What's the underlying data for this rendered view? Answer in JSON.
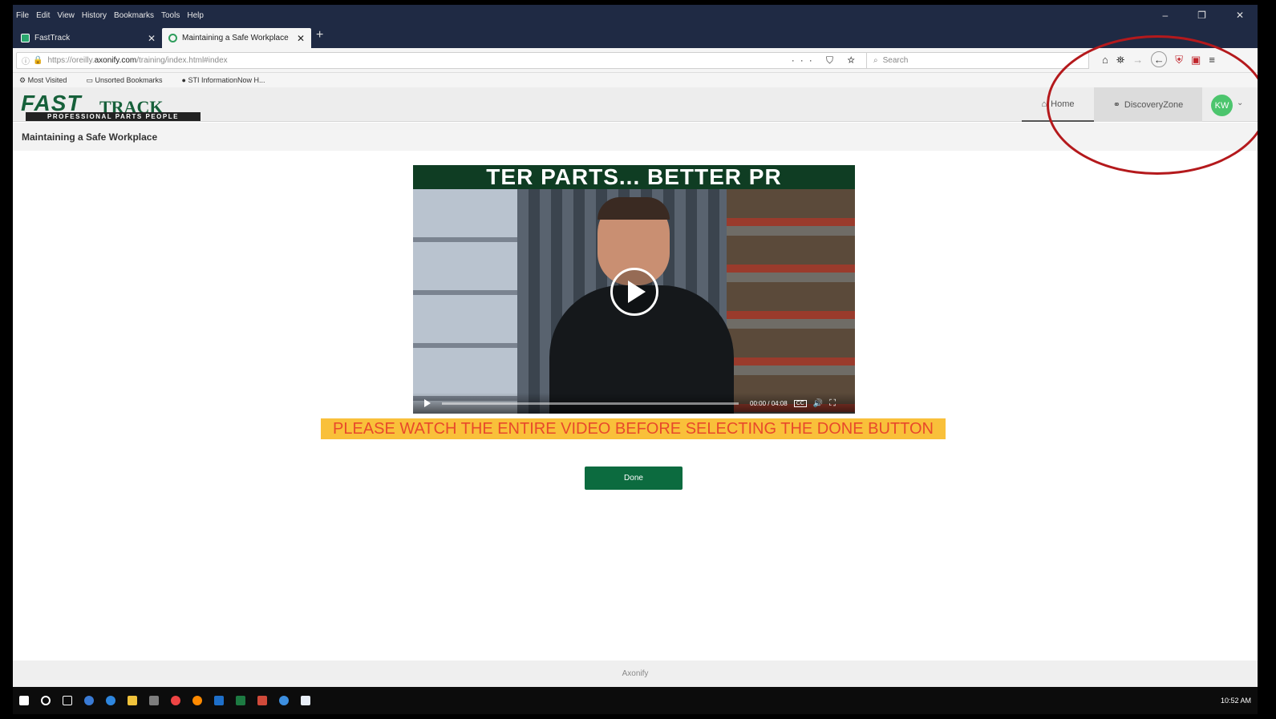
{
  "menu": [
    "File",
    "Edit",
    "View",
    "History",
    "Bookmarks",
    "Tools",
    "Help"
  ],
  "window_controls": {
    "minimize": "–",
    "restore": "❐",
    "close": "✕"
  },
  "tabs": [
    {
      "label": "FastTrack",
      "close": "✕"
    },
    {
      "label": "Maintaining a Safe Workplace",
      "close": "✕"
    }
  ],
  "new_tab": "+",
  "url": {
    "prefix": "https://oreilly.",
    "host": "axonify.com",
    "path": "/training/index.html#index"
  },
  "url_buttons": "··· ⛉ ☆",
  "search": {
    "placeholder": "Search"
  },
  "bookmarks": [
    "Most Visited",
    "Unsorted Bookmarks",
    "STI InformationNow H..."
  ],
  "logo": {
    "fast": "FAST",
    "track": "TRACK",
    "tagline": "PROFESSIONAL PARTS PEOPLE"
  },
  "app_nav": {
    "home": "Home",
    "discovery": "DiscoveryZone",
    "avatar": "KW"
  },
  "page_title": "Maintaining a Safe Workplace",
  "video": {
    "banner": "TER PARTS... BETTER PR",
    "time": "00:00 / 04:08",
    "cc": "CC"
  },
  "notice": "PLEASE WATCH THE ENTIRE VIDEO BEFORE SELECTING THE DONE BUTTON",
  "done_label": "Done",
  "footer": "Axonify",
  "clock": "10:52 AM",
  "colors": {
    "brand_green": "#0c6b3f",
    "notice_bg": "#f9c03a",
    "notice_text": "#e8492b",
    "annotation": "#b4191c"
  }
}
